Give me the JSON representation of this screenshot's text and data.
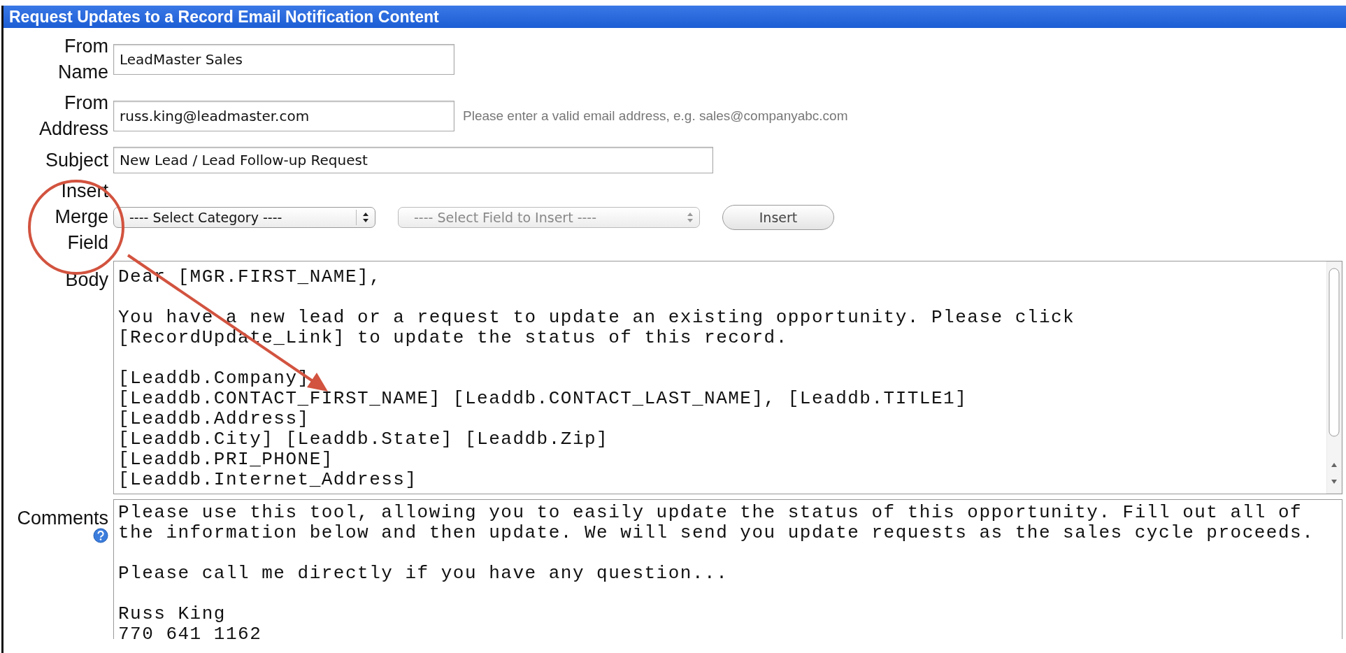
{
  "header": {
    "title": "Request Updates to a Record Email Notification Content"
  },
  "rows": [
    {
      "kind": "text",
      "label": "From Name",
      "value": "LeadMaster Sales"
    },
    {
      "kind": "text",
      "label": "From Address",
      "value": "russ.king@leadmaster.com",
      "hint": "Please enter a valid email address, e.g. sales@companyabc.com"
    },
    {
      "kind": "wide-text",
      "label": "Subject",
      "value": "New Lead / Lead Follow-up Request"
    },
    {
      "kind": "merge",
      "label": "Insert Merge Field",
      "selects": [
        {
          "text": "---- Select Category ----",
          "disabled": false
        },
        {
          "text": "---- Select Field to Insert ----",
          "disabled": true
        }
      ],
      "button": "Insert"
    },
    {
      "kind": "area",
      "label": "Body",
      "paragraphs": [
        [
          "Dear [MGR.FIRST_NAME],"
        ],
        [
          "You have a new lead or a request to update an existing opportunity. Please click",
          "[RecordUpdate_Link] to update the status of this record."
        ],
        [
          "[Leaddb.Company]",
          "[Leaddb.CONTACT_FIRST_NAME] [Leaddb.CONTACT_LAST_NAME], [Leaddb.TITLE1]",
          "[Leaddb.Address]",
          "[Leaddb.City] [Leaddb.State] [Leaddb.Zip]",
          "[Leaddb.PRI_PHONE]",
          "[Leaddb.Internet_Address]"
        ]
      ],
      "scrollbar": true
    },
    {
      "kind": "area",
      "label": "Comments",
      "help": true,
      "paragraphs": [
        [
          "Please use this tool, allowing you to easily update the status of this opportunity. Fill out all of",
          "the information below and then update. We will send you update requests as the sales cycle proceeds."
        ],
        [
          "Please call me directly if you have any question..."
        ],
        [
          "Russ King",
          "770 641 1162"
        ]
      ]
    }
  ]
}
